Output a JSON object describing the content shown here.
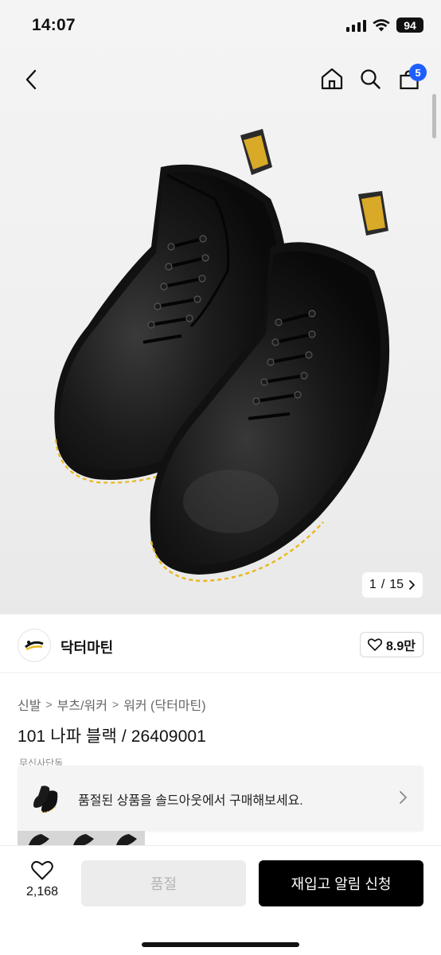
{
  "status_bar": {
    "time": "14:07",
    "battery": "94",
    "icons": [
      "cellular-signal-icon",
      "wifi-icon",
      "battery-icon"
    ]
  },
  "nav": {
    "icons": [
      "back-chevron-icon",
      "home-icon",
      "search-icon",
      "cart-icon"
    ],
    "cart_count": "5"
  },
  "gallery": {
    "current": "1",
    "separator": "/",
    "total": "15"
  },
  "brand": {
    "name": "닥터마틴",
    "likes": "8.9만"
  },
  "breadcrumb": {
    "items": [
      "신발",
      "부츠/워커",
      "워커 (닥터마틴)"
    ],
    "separator": ">"
  },
  "product": {
    "title": "101 나파 블랙 / 26409001"
  },
  "partial_label": "무신사단독",
  "soldout_banner": {
    "text": "품절된 상품을 솔드아웃에서 구매해보세요."
  },
  "actions": {
    "wish_count": "2,168",
    "soldout_label": "품절",
    "restock_label": "재입고 알림 신청"
  },
  "colors": {
    "accent_blue": "#1e5eff",
    "primary_black": "#000000",
    "disabled_gray": "#ececec",
    "stitch_yellow": "#e8b71a"
  }
}
